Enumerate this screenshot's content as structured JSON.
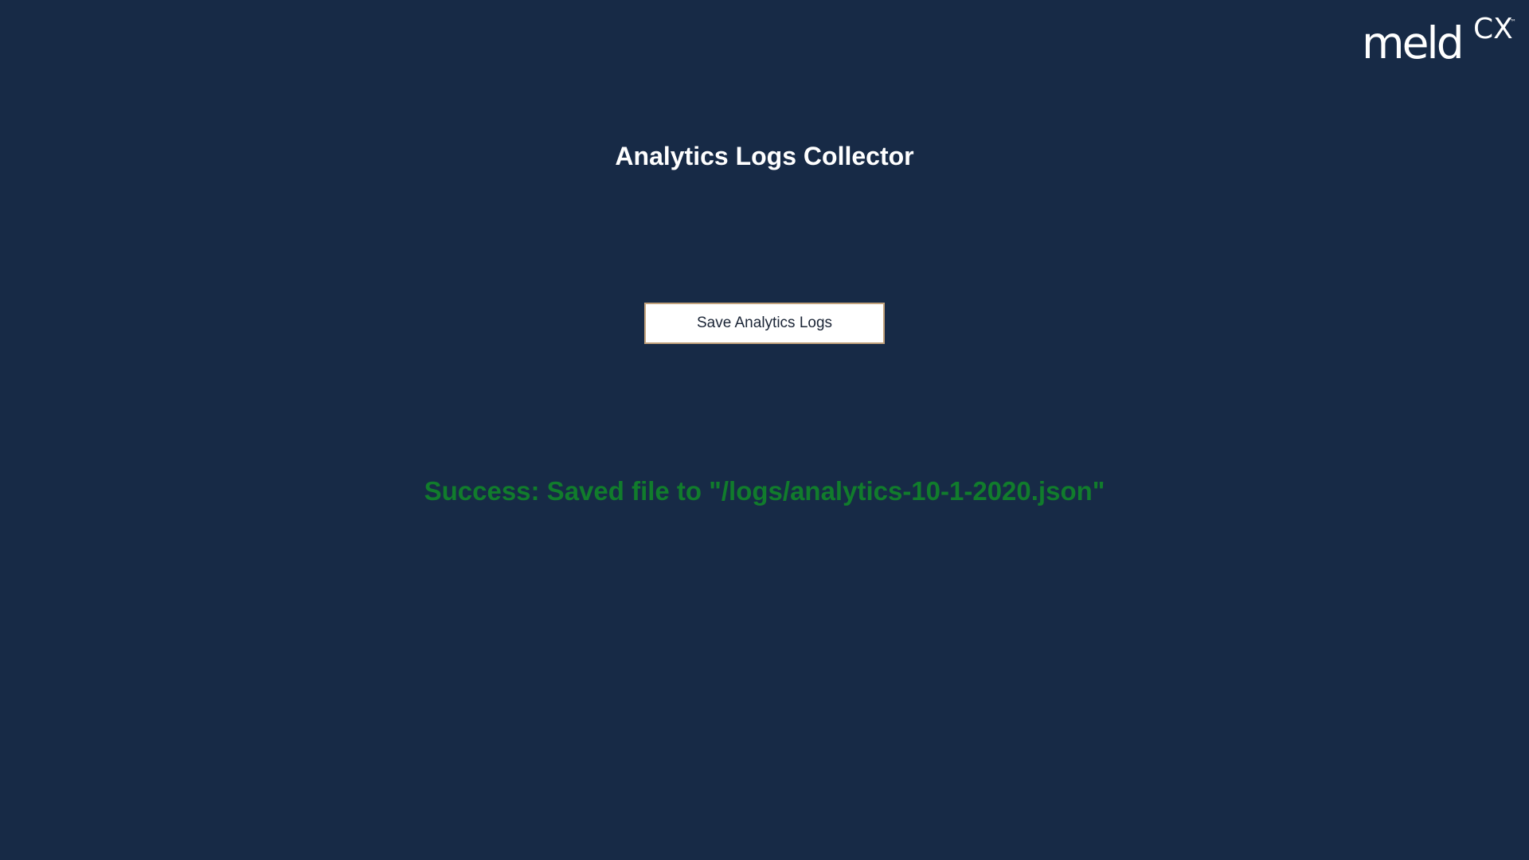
{
  "logo": {
    "text": "meld",
    "suffix": "CX",
    "trademark": "™"
  },
  "page": {
    "title": "Analytics Logs Collector"
  },
  "actions": {
    "save_label": "Save Analytics Logs"
  },
  "status": {
    "message": "Success: Saved file to \"/logs/analytics-10-1-2020.json\"",
    "color": "#117c2c"
  },
  "theme": {
    "background": "#172a46",
    "button_border": "#c2a27c"
  }
}
